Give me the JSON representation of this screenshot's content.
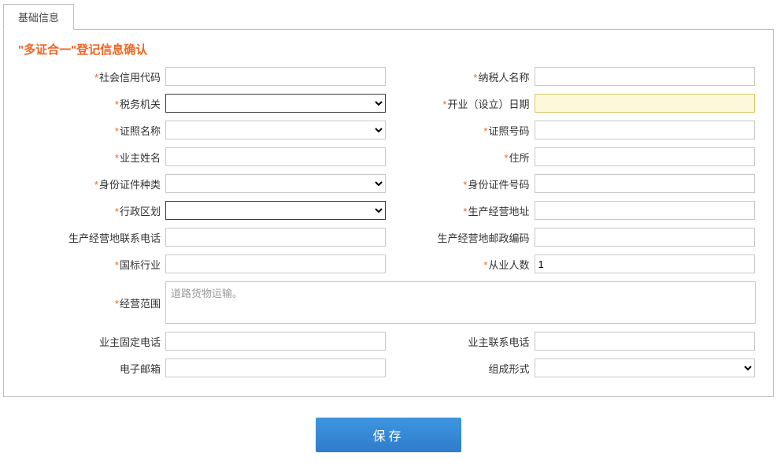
{
  "tab": {
    "label": "基础信息"
  },
  "section_title": "\"多证合一\"登记信息确认",
  "labels": {
    "social_credit_code": "社会信用代码",
    "taxpayer_name": "纳税人名称",
    "tax_authority": "税务机关",
    "open_date": "开业（设立）日期",
    "cert_name": "证照名称",
    "cert_number": "证照号码",
    "owner_name": "业主姓名",
    "residence": "住所",
    "id_type": "身份证件种类",
    "id_number": "身份证件号码",
    "admin_division": "行政区划",
    "biz_address": "生产经营地址",
    "biz_phone": "生产经营地联系电话",
    "biz_postal": "生产经营地邮政编码",
    "national_industry": "国标行业",
    "employee_count": "从业人数",
    "biz_scope": "经营范围",
    "owner_fixed_phone": "业主固定电话",
    "owner_contact_phone": "业主联系电话",
    "email": "电子邮箱",
    "composition_form": "组成形式"
  },
  "values": {
    "social_credit_code": "",
    "taxpayer_name": "",
    "tax_authority": "",
    "open_date": "",
    "cert_name": "",
    "cert_number": "",
    "owner_name": "",
    "residence": "",
    "id_type": "",
    "id_number": "",
    "admin_division": "",
    "biz_address": "",
    "biz_phone": "",
    "biz_postal": "",
    "national_industry": "",
    "employee_count": "1",
    "biz_scope": "道路货物运输。",
    "owner_fixed_phone": "",
    "owner_contact_phone": "",
    "email": "",
    "composition_form": ""
  },
  "buttons": {
    "save": "保存"
  }
}
